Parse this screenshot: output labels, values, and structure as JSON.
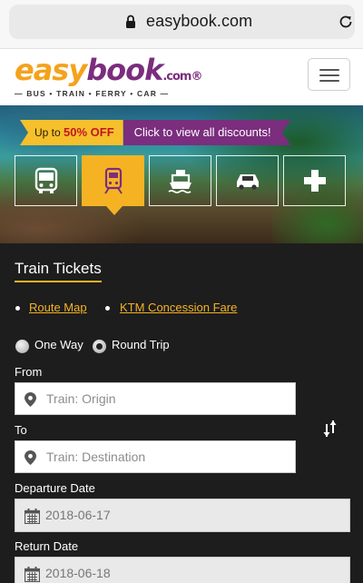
{
  "browser": {
    "url": "easybook.com"
  },
  "header": {
    "logo": {
      "easy": "easy",
      "book": "book",
      "com": ".com®",
      "tagline": "— BUS • TRAIN • FERRY • CAR —"
    },
    "menu_icon": "hamburger-icon"
  },
  "promo": {
    "prefix": "Up to ",
    "highlight": "50% OFF",
    "cta": "Click to view all discounts!"
  },
  "transport_tabs": [
    {
      "name": "bus",
      "icon": "bus-icon",
      "active": false
    },
    {
      "name": "train",
      "icon": "train-icon",
      "active": true
    },
    {
      "name": "ferry",
      "icon": "ferry-icon",
      "active": false
    },
    {
      "name": "car",
      "icon": "car-icon",
      "active": false
    },
    {
      "name": "more",
      "icon": "plus-icon",
      "active": false
    }
  ],
  "booking": {
    "title": "Train Tickets",
    "links": [
      "Route Map",
      "KTM Concession Fare"
    ],
    "trip_type": {
      "one_way": "One Way",
      "round_trip": "Round Trip",
      "selected": "Round Trip"
    },
    "from_label": "From",
    "from_placeholder": "Train: Origin",
    "to_label": "To",
    "to_placeholder": "Train: Destination",
    "departure_label": "Departure Date",
    "departure_value": "2018-06-17",
    "return_label": "Return Date",
    "return_value": "2018-06-18"
  },
  "colors": {
    "brand_orange": "#f5b324",
    "brand_purple": "#7b2d7e",
    "panel_bg": "#1d1d1d"
  }
}
